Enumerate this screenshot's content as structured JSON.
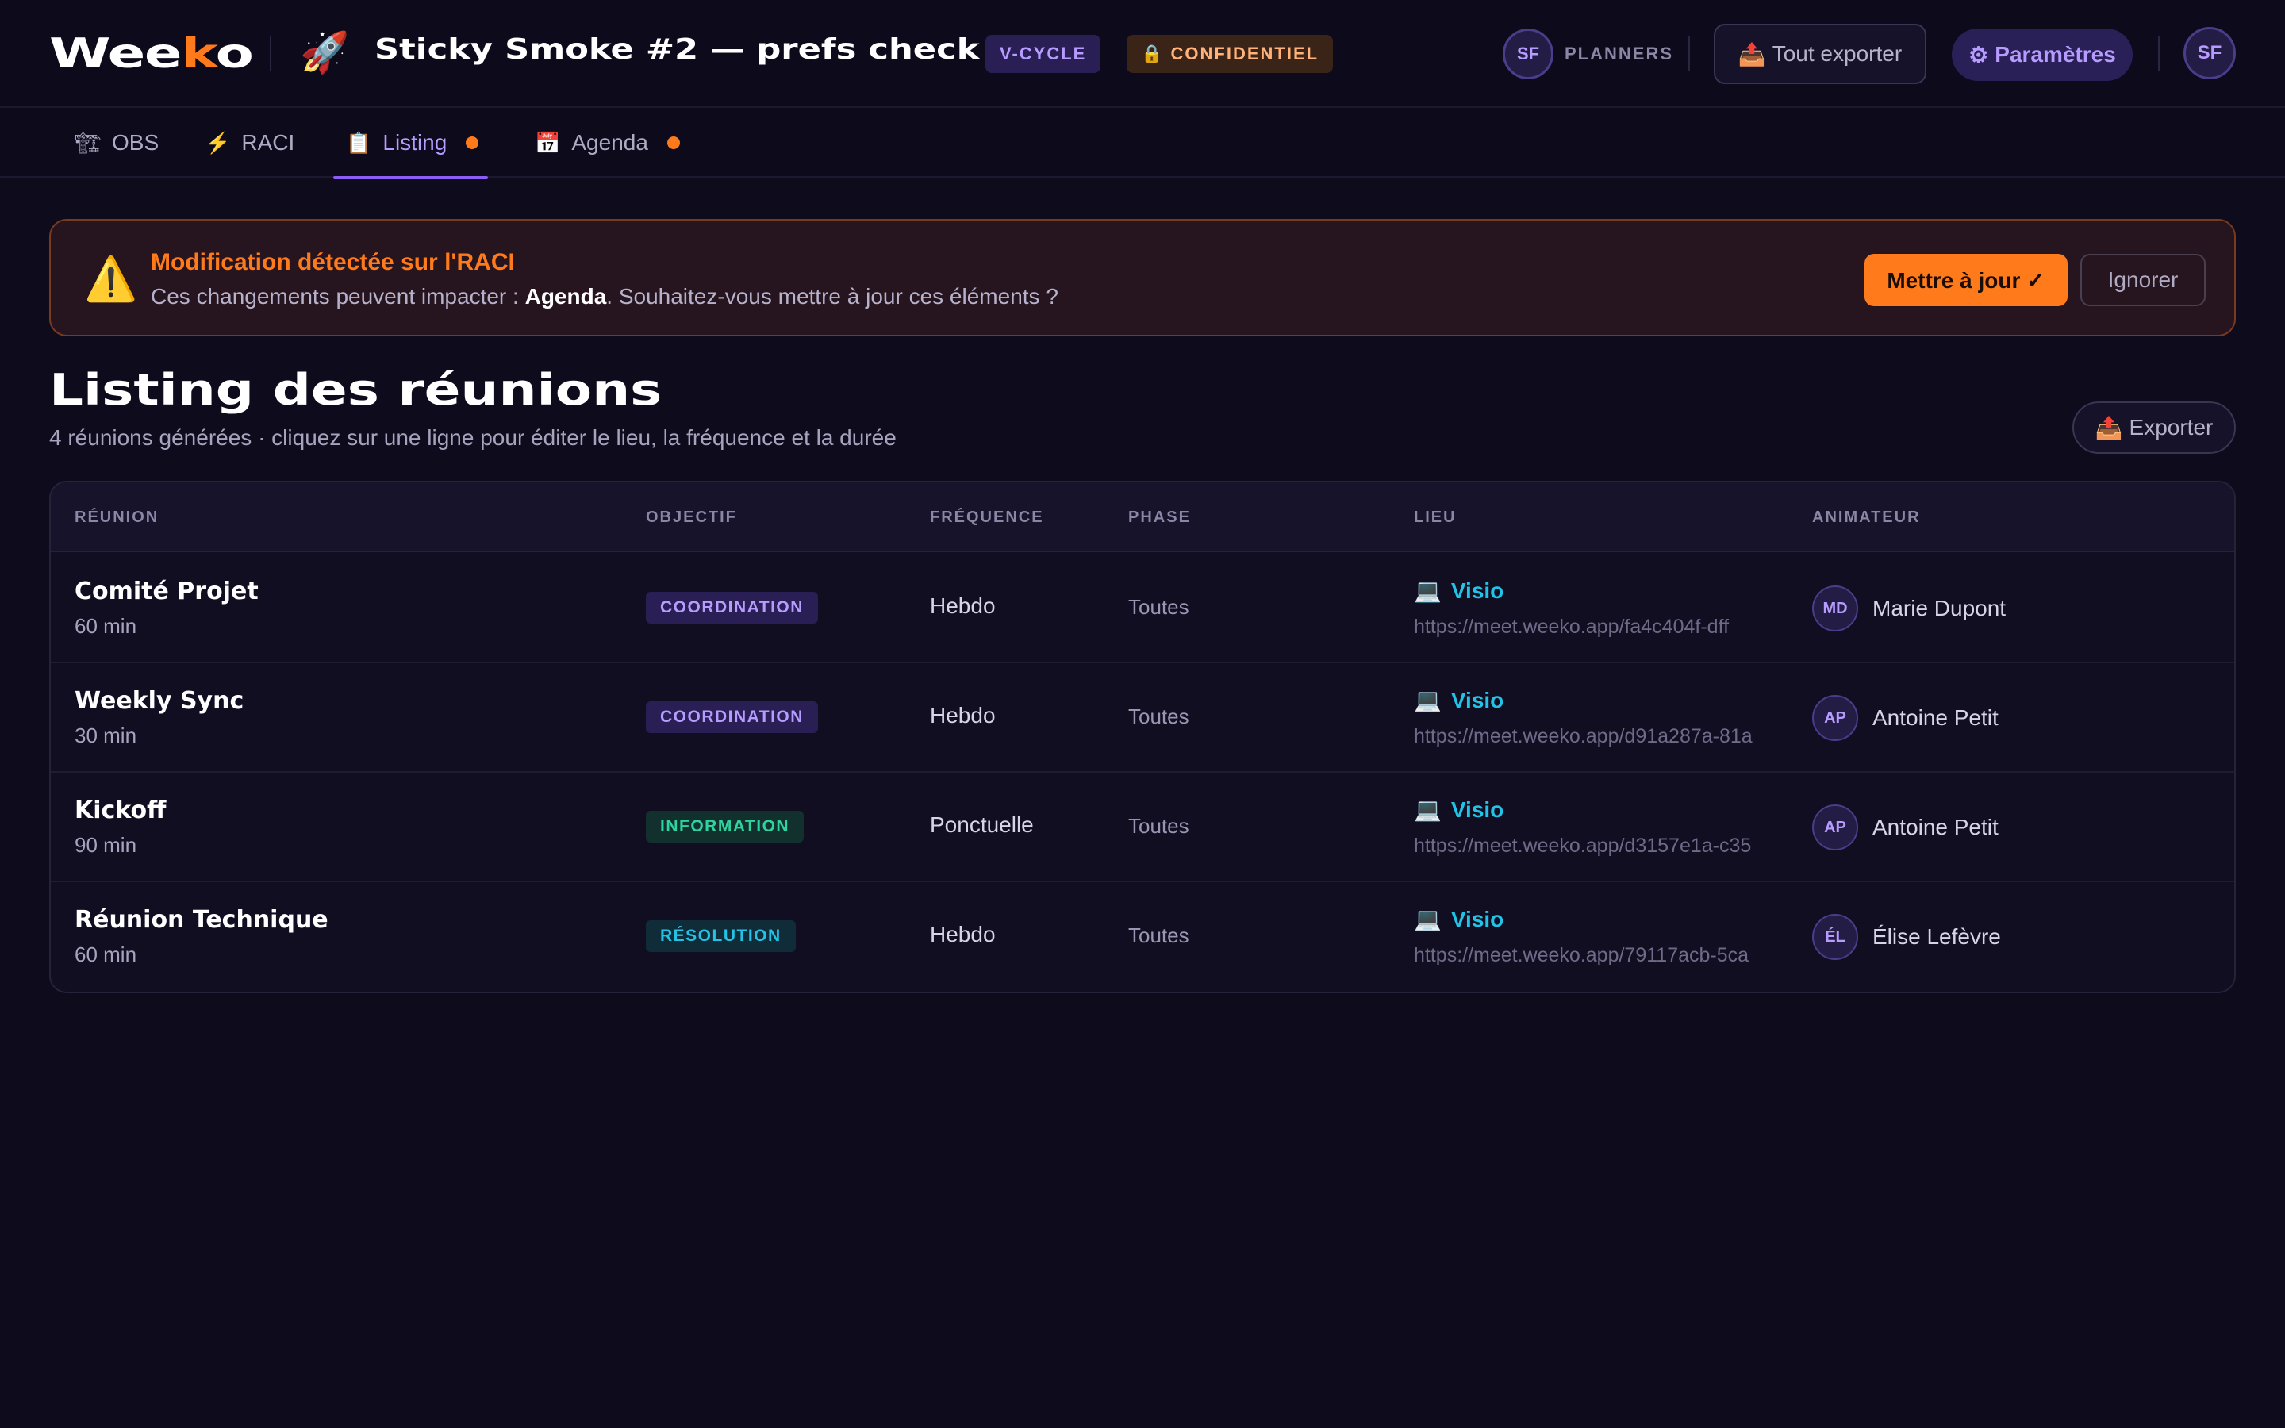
{
  "colors": {
    "background": "#0e0b1d",
    "brand_accent": "#ff7a1a",
    "purple_accent": "#8b5cf6",
    "link_cyan": "#22c3e6"
  },
  "header": {
    "logo_pre": "Wee",
    "logo_accent": "k",
    "logo_post": "o",
    "project_icon": "rocket-icon",
    "project_emoji": "🚀",
    "project_title": "Sticky Smoke #2 — prefs check",
    "badge_method": "V-CYCLE",
    "badge_confidential": "🔒 CONFIDENTIEL",
    "planners_avatar": "SF",
    "planners_label": "PLANNERS",
    "export_all_icon": "📤",
    "export_all_label": "Tout exporter",
    "settings_icon": "⚙",
    "settings_label": "Paramètres",
    "user_avatar": "SF"
  },
  "tabs": [
    {
      "icon": "🏗",
      "label": "OBS",
      "dot": false
    },
    {
      "icon": "⚡",
      "label": "RACI",
      "dot": false
    },
    {
      "icon": "📋",
      "label": "Listing",
      "dot": true,
      "active": true
    },
    {
      "icon": "📅",
      "label": "Agenda",
      "dot": true
    }
  ],
  "alert": {
    "icon": "⚠️",
    "title": "Modification détectée sur l'RACI",
    "msg_pre": "Ces changements peuvent impacter : ",
    "msg_bold": "Agenda",
    "msg_post": ". Souhaitez-vous mettre à jour ces éléments ?",
    "update_label": "Mettre à jour ✓",
    "ignore_label": "Ignorer"
  },
  "page": {
    "title": "Listing des réunions",
    "subtitle": "4 réunions générées · cliquez sur une ligne pour éditer le lieu, la fréquence et la durée",
    "export_icon": "📤",
    "export_label": "Exporter"
  },
  "table": {
    "headers": {
      "reunion": "RÉUNION",
      "objectif": "OBJECTIF",
      "frequence": "FRÉQUENCE",
      "phase": "PHASE",
      "lieu": "LIEU",
      "animateur": "ANIMATEUR"
    },
    "rows": [
      {
        "name": "Comité Projet",
        "duration": "60 min",
        "objective": "COORDINATION",
        "objective_bg": "#2a1f55",
        "objective_color": "#b79cff",
        "frequency": "Hebdo",
        "phase": "Toutes",
        "lieu_icon": "💻",
        "lieu_type": "Visio",
        "lieu_url": "https://meet.weeko.app/fa4c404f-dff",
        "anim_initials": "MD",
        "anim_name": "Marie Dupont"
      },
      {
        "name": "Weekly Sync",
        "duration": "30 min",
        "objective": "COORDINATION",
        "objective_bg": "#2a1f55",
        "objective_color": "#b79cff",
        "frequency": "Hebdo",
        "phase": "Toutes",
        "lieu_icon": "💻",
        "lieu_type": "Visio",
        "lieu_url": "https://meet.weeko.app/d91a287a-81a",
        "anim_initials": "AP",
        "anim_name": "Antoine Petit"
      },
      {
        "name": "Kickoff",
        "duration": "90 min",
        "objective": "INFORMATION",
        "objective_bg": "#12302e",
        "objective_color": "#2ed3a0",
        "frequency": "Ponctuelle",
        "phase": "Toutes",
        "lieu_icon": "💻",
        "lieu_type": "Visio",
        "lieu_url": "https://meet.weeko.app/d3157e1a-c35",
        "anim_initials": "AP",
        "anim_name": "Antoine Petit"
      },
      {
        "name": "Réunion Technique",
        "duration": "60 min",
        "objective": "RÉSOLUTION",
        "objective_bg": "#102c38",
        "objective_color": "#22c3e6",
        "frequency": "Hebdo",
        "phase": "Toutes",
        "lieu_icon": "💻",
        "lieu_type": "Visio",
        "lieu_url": "https://meet.weeko.app/79117acb-5ca",
        "anim_initials": "ÉL",
        "anim_name": "Élise Lefèvre"
      }
    ]
  }
}
